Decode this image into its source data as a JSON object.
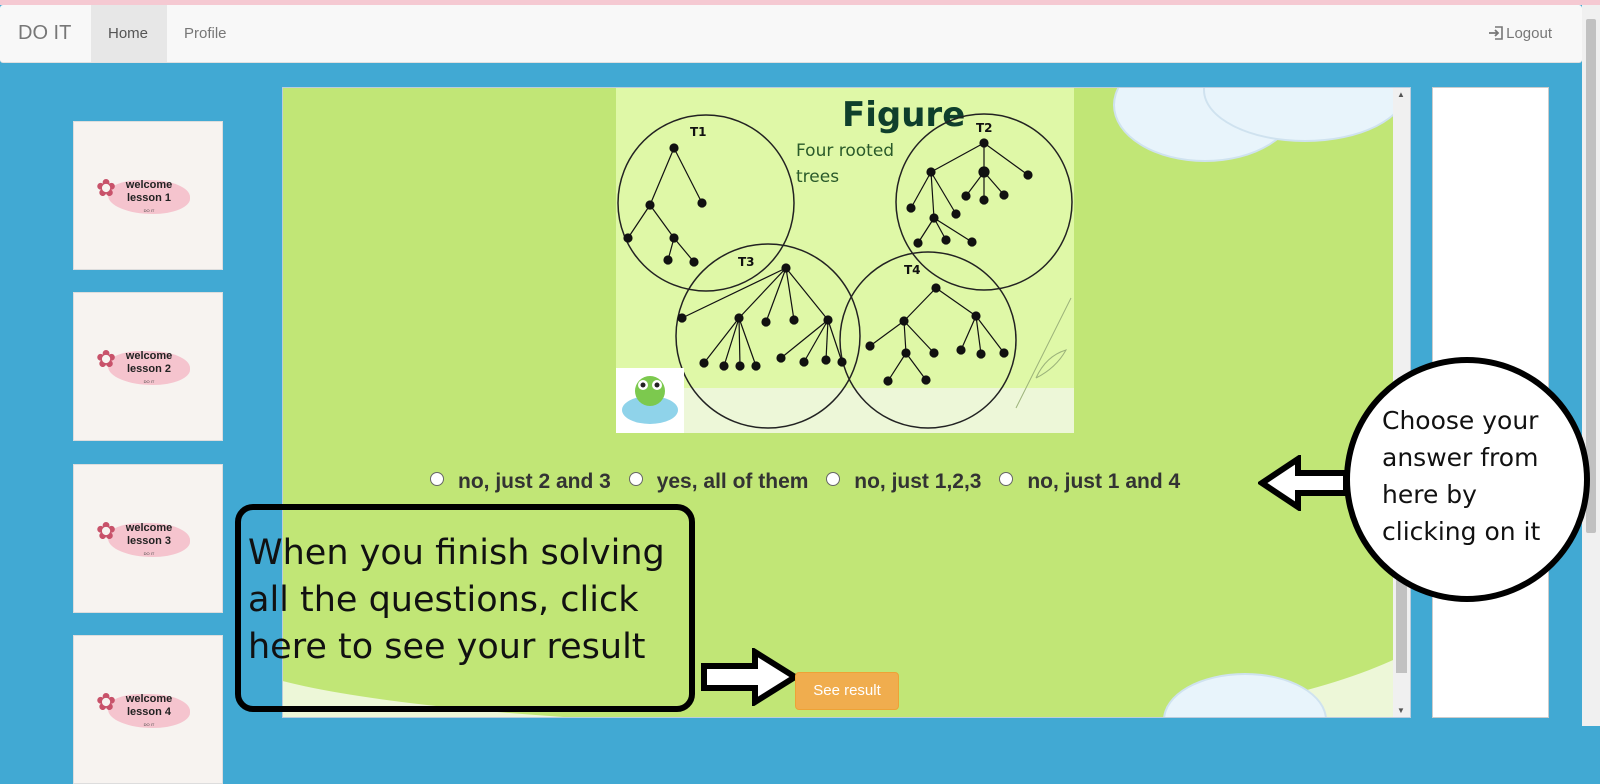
{
  "navbar": {
    "brand": "DO IT",
    "home": "Home",
    "profile": "Profile",
    "logout": "Logout"
  },
  "lessons": [
    {
      "title": "welcome\nlesson 1",
      "tiny": "DO IT"
    },
    {
      "title": "welcome\nlesson 2",
      "tiny": "DO IT"
    },
    {
      "title": "welcome\nlesson 3",
      "tiny": "DO IT"
    },
    {
      "title": "welcome\nlesson 4",
      "tiny": "DO IT"
    }
  ],
  "figure": {
    "title": "Figure",
    "subtitle": "Four rooted\ntrees",
    "tree_labels": [
      "T1",
      "T2",
      "T3",
      "T4"
    ]
  },
  "answers": [
    {
      "label": "no, just 2 and 3"
    },
    {
      "label": "yes, all of them"
    },
    {
      "label": "no, just 1,2,3"
    },
    {
      "label": "no, just 1 and 4"
    }
  ],
  "callouts": {
    "result_hint": "When you finish solving all the questions, click here to see your result",
    "answer_hint": "Choose your answer from here by clicking on it"
  },
  "see_result": "See result",
  "colors": {
    "page_bg": "#41a9d3",
    "content_green": "#c1e676",
    "button_orange": "#f0ad4e"
  }
}
